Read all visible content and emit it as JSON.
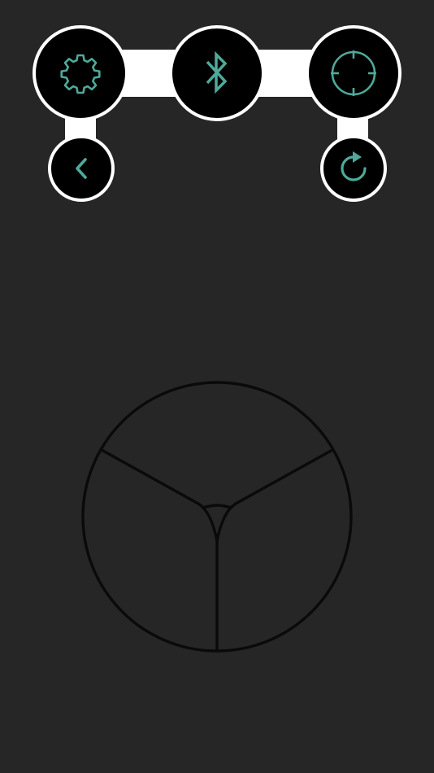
{
  "colors": {
    "background": "#262626",
    "accent": "#4fa99a",
    "button_fill": "#000000",
    "button_border": "#ffffff",
    "connector": "#ffffff",
    "joystick_stroke": "#0a0a0a"
  },
  "toolbar": {
    "buttons": [
      {
        "id": "settings",
        "icon": "gear-icon"
      },
      {
        "id": "bluetooth",
        "icon": "bluetooth-icon"
      },
      {
        "id": "target",
        "icon": "crosshair-icon"
      },
      {
        "id": "back",
        "icon": "chevron-left-icon"
      },
      {
        "id": "refresh",
        "icon": "refresh-icon"
      }
    ]
  },
  "joystick": {
    "segments": 3
  }
}
